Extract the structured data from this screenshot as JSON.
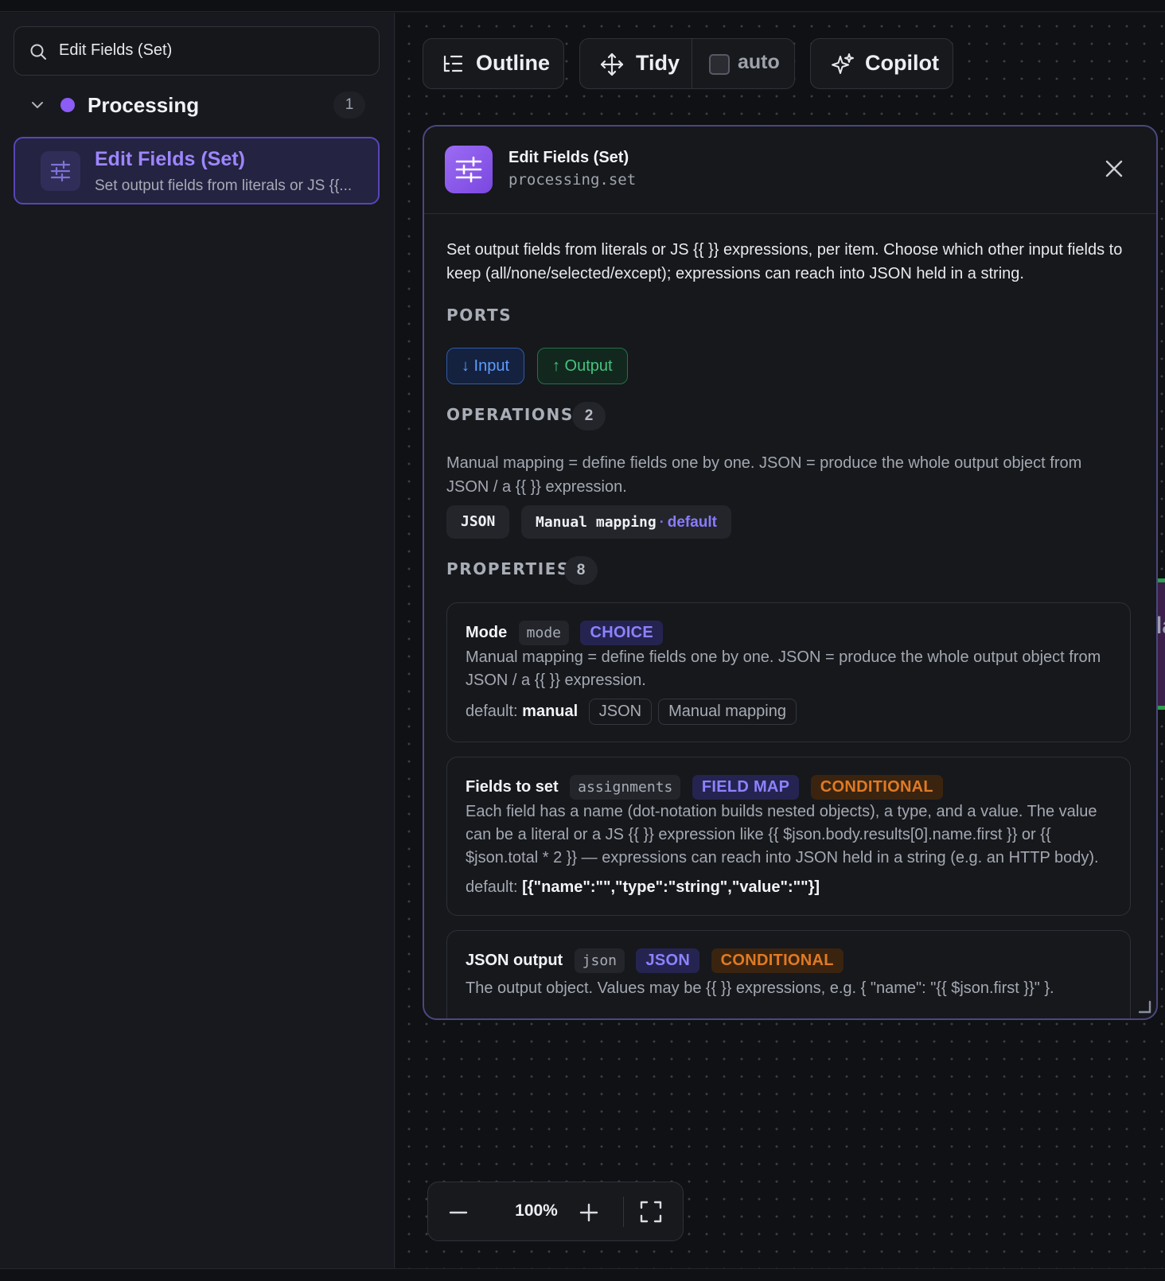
{
  "sidebar": {
    "search": {
      "value": "Edit Fields (Set)",
      "icon": "search-icon"
    },
    "group": {
      "label": "Processing",
      "count": "1",
      "dot_color": "#8b5cf6"
    },
    "node": {
      "title": "Edit Fields (Set)",
      "subtitle": "Set output fields from literals or JS {{..."
    }
  },
  "toolbar": {
    "outline_label": "Outline",
    "tidy_label": "Tidy",
    "auto_label": "auto",
    "copilot_label": "Copilot"
  },
  "panel": {
    "title": "Edit Fields (Set)",
    "code": "processing.set",
    "description": "Set output fields from literals or JS {{ }} expressions, per item. Choose which other input fields to keep (all/none/selected/except); expressions can reach into JSON held in a string.",
    "ports": {
      "heading": "PORTS",
      "input_label": "↓ Input",
      "output_label": "↑ Output"
    },
    "operations": {
      "heading": "OPERATIONS",
      "count": "2",
      "description": "Manual mapping = define fields one by one. JSON = produce the whole output object from JSON / a {{ }} expression.",
      "chips": [
        "JSON",
        "Manual mapping"
      ],
      "default_marker": "·",
      "default_label": "default"
    },
    "properties": {
      "heading": "PROPERTIES",
      "count": "8",
      "items": [
        {
          "name": "Mode",
          "key": "mode",
          "type": "CHOICE",
          "description": "Manual mapping = define fields one by one. JSON = produce the whole output object from JSON / a {{ }} expression.",
          "default_prefix": "default:",
          "default_value": "manual",
          "options": [
            "JSON",
            "Manual mapping"
          ]
        },
        {
          "name": "Fields to set",
          "key": "assignments",
          "type": "FIELD MAP",
          "flag": "CONDITIONAL",
          "description": "Each field has a name (dot-notation builds nested objects), a type, and a value. The value can be a literal or a JS {{ }} expression like {{ $json.body.results[0].name.first }} or {{ $json.total * 2 }} — expressions can reach into JSON held in a string (e.g. an HTTP body).",
          "default_prefix": "default:",
          "default_value": "[{\"name\":\"\",\"type\":\"string\",\"value\":\"\"}]"
        },
        {
          "name": "JSON output",
          "key": "json",
          "type": "JSON",
          "flag": "CONDITIONAL",
          "description": "The output object. Values may be {{ }} expressions, e.g. { \"name\": \"{{ $json.first }}\" }."
        }
      ]
    }
  },
  "canvas_peek": {
    "text": "la"
  },
  "zoom": {
    "level": "100%"
  },
  "colors": {
    "accent": "#8b5cf6",
    "selected_border": "#5746b8",
    "conditional": "#e07a24",
    "port_input": "#5f9bff",
    "port_output": "#47c27f"
  }
}
